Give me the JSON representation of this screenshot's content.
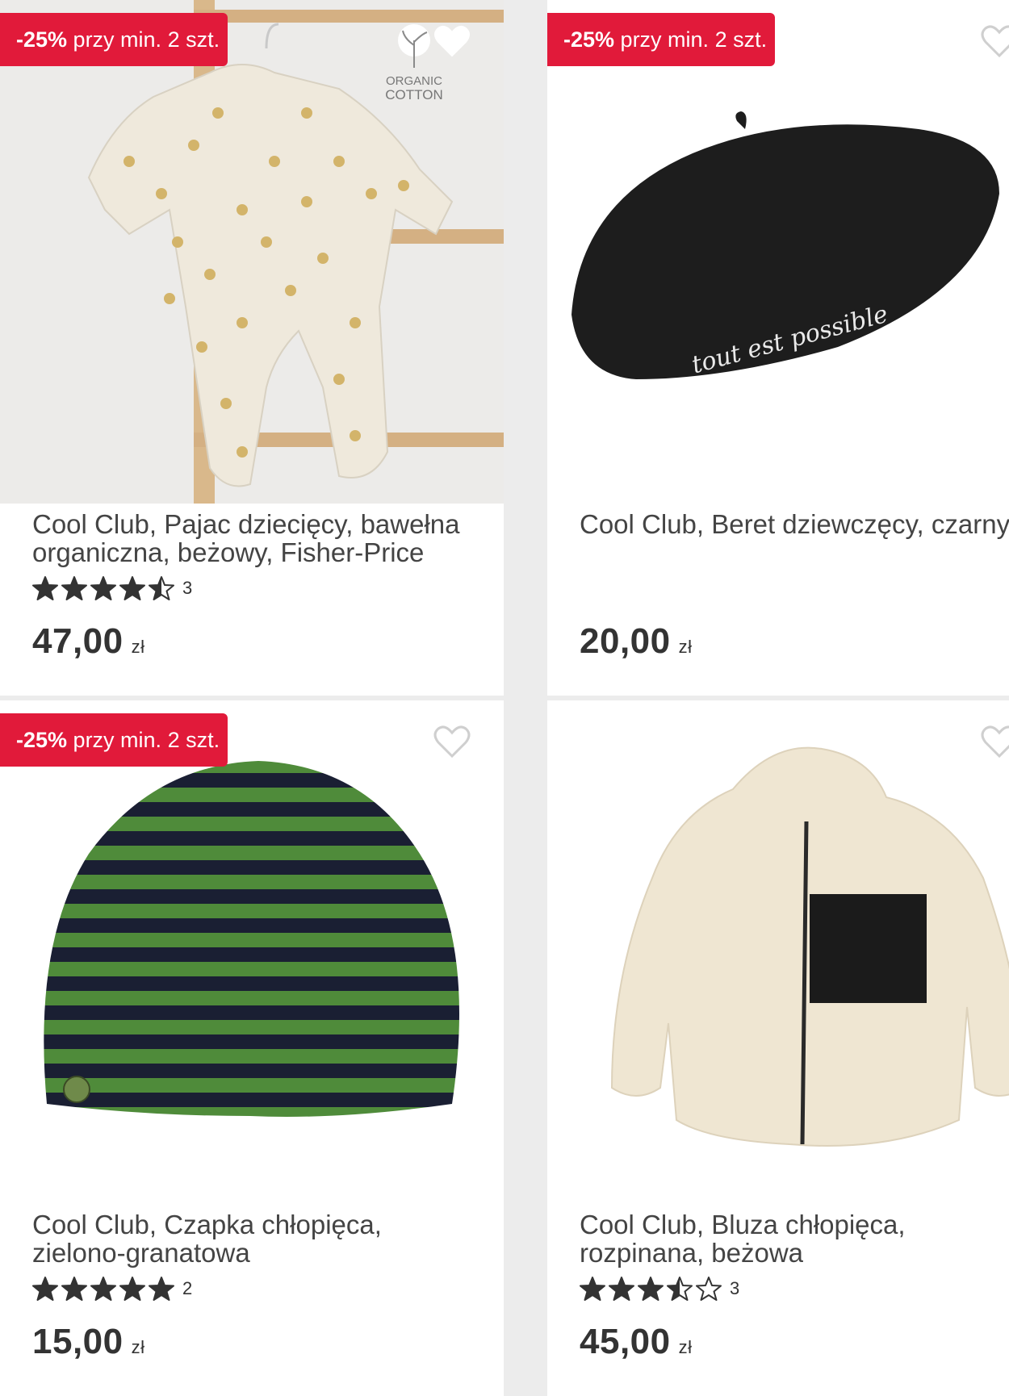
{
  "products": [
    {
      "badge_discount": "-25%",
      "badge_text": "przy min. 2 szt.",
      "organic_label_1": "ORGANIC",
      "organic_label_2": "COTTON",
      "title": "Cool Club, Pajac dziecięcy, bawełna\norganiczna, beżowy, Fisher-Price",
      "rating": 4.5,
      "rating_count": "3",
      "price": "47,00",
      "currency": "zł"
    },
    {
      "badge_discount": "-25%",
      "badge_text": "przy min. 2 szt.",
      "beret_text": "tout est possible",
      "title": "Cool Club, Beret dziewczęcy, czarny",
      "price": "20,00",
      "currency": "zł"
    },
    {
      "badge_discount": "-25%",
      "badge_text": "przy min. 2 szt.",
      "title": "Cool Club, Czapka chłopięca,\nzielono-granatowa",
      "rating": 5,
      "rating_count": "2",
      "price": "15,00",
      "currency": "zł"
    },
    {
      "title": "Cool Club, Bluza chłopięca,\nrozpinana, beżowa",
      "rating": 3.5,
      "rating_count": "3",
      "price": "45,00",
      "currency": "zł"
    }
  ],
  "colors": {
    "badge": "#e11a3a",
    "star": "#333333",
    "background": "#ececec"
  }
}
